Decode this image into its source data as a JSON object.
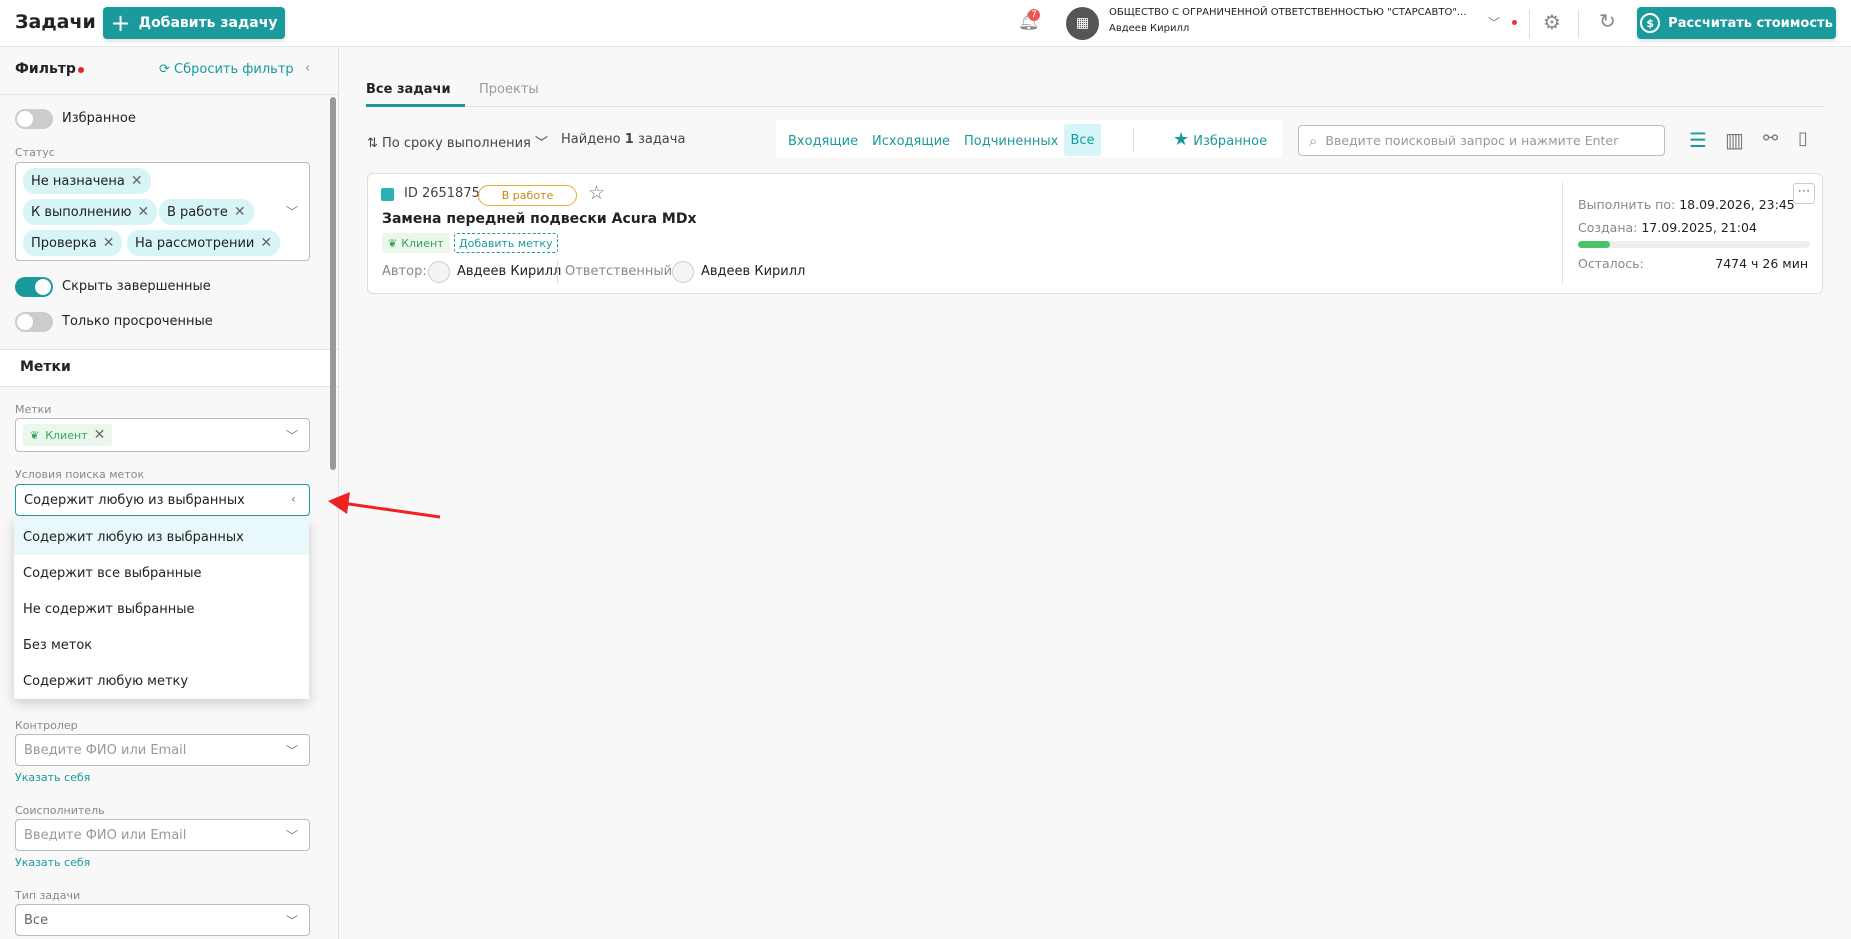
{
  "header": {
    "title": "Задачи",
    "add_task": "Добавить задачу",
    "notifications_count": "7",
    "org_name": "ОБЩЕСТВО С ОГРАНИЧЕННОЙ ОТВЕТСТВЕННОСТЬЮ \"СТАРСАВТО\"...",
    "user_name": "Авдеев Кирилл",
    "calc_button": "Рассчитать стоимость",
    "accent": "#1a9a9c"
  },
  "filter": {
    "title": "Фильтр",
    "reset": "Сбросить фильтр",
    "favorites": "Избранное",
    "status_label": "Статус",
    "statuses": [
      "Не назначена",
      "К выполнению",
      "В работе",
      "Проверка",
      "На рассмотрении"
    ],
    "hide_completed": "Скрыть завершенные",
    "only_overdue": "Только просроченные",
    "tags_section": "Метки",
    "tags_label": "Метки",
    "tag_selected": "Клиент",
    "tag_condition_label": "Условия поиска меток",
    "tag_condition_value": "Содержит любую из выбранных",
    "tag_condition_options": [
      "Содержит любую из выбранных",
      "Содержит все выбранные",
      "Не содержит выбранные",
      "Без меток",
      "Содержит любую метку"
    ],
    "controller_label": "Контролер",
    "controller_placeholder": "Введите ФИО или Email",
    "set_self": "Указать себя",
    "coexecutor_label": "Соисполнитель",
    "coexecutor_placeholder": "Введите ФИО или Email",
    "task_type_label": "Тип задачи",
    "task_type_value": "Все"
  },
  "main": {
    "tabs": [
      "Все задачи",
      "Проекты"
    ],
    "sort": "По сроку выполнения",
    "found_prefix": "Найдено ",
    "found_count": "1",
    "found_suffix": " задача",
    "segments": [
      "Входящие",
      "Исходящие",
      "Подчиненных",
      "Все"
    ],
    "favorites": "Избранное",
    "search_placeholder": "Введите поисковый запрос и нажмите Enter"
  },
  "task": {
    "id": "ID 2651875",
    "status": "В работе",
    "title": "Замена передней подвески Acura MDx",
    "tag": "Клиент",
    "add_tag": "Добавить метку",
    "author_label": "Автор:",
    "author": "Авдеев Кирилл",
    "responsible_label": "Ответственный:",
    "responsible": "Авдеев Кирилл",
    "due_label": "Выполнить по:",
    "due": "18.09.2026, 23:45",
    "created_label": "Создана:",
    "created": "17.09.2025, 21:04",
    "remaining_label": "Осталось:",
    "remaining": "7474 ч 26 мин",
    "progress_percent": 14
  }
}
